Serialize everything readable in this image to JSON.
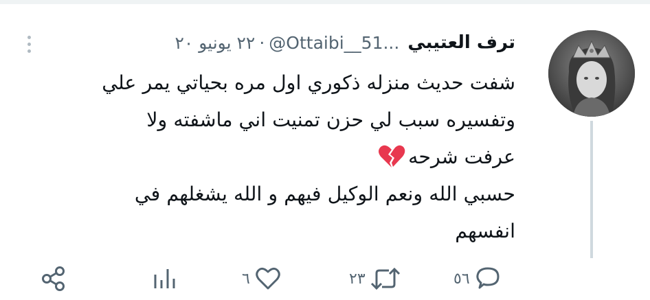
{
  "tweet": {
    "display_name": "ترف العتيبي",
    "handle": "@Ottaibi__51...",
    "separator": "·",
    "date": "٢٢ يونيو ٢٠",
    "lines": [
      "شفت حديث منزله ذكوري اول مره بحياتي يمر علي",
      "وتفسيره سبب لي حزن تمنيت اني ماشفته ولا",
      "عرفت شرحه",
      "حسبي الله ونعم الوكيل فيهم و الله يشغلهم في",
      "انفسهم"
    ],
    "emoji": "broken-heart-icon"
  },
  "actions": {
    "reply_count": "٥٦",
    "retweet_count": "٢٣",
    "like_count": "٦",
    "share_icon": "share-icon",
    "analytics_icon": "analytics-icon"
  },
  "colors": {
    "text": "#0f1419",
    "secondary": "#536471",
    "thread_line": "#cfd9de",
    "heart_red": "#e8384f"
  }
}
